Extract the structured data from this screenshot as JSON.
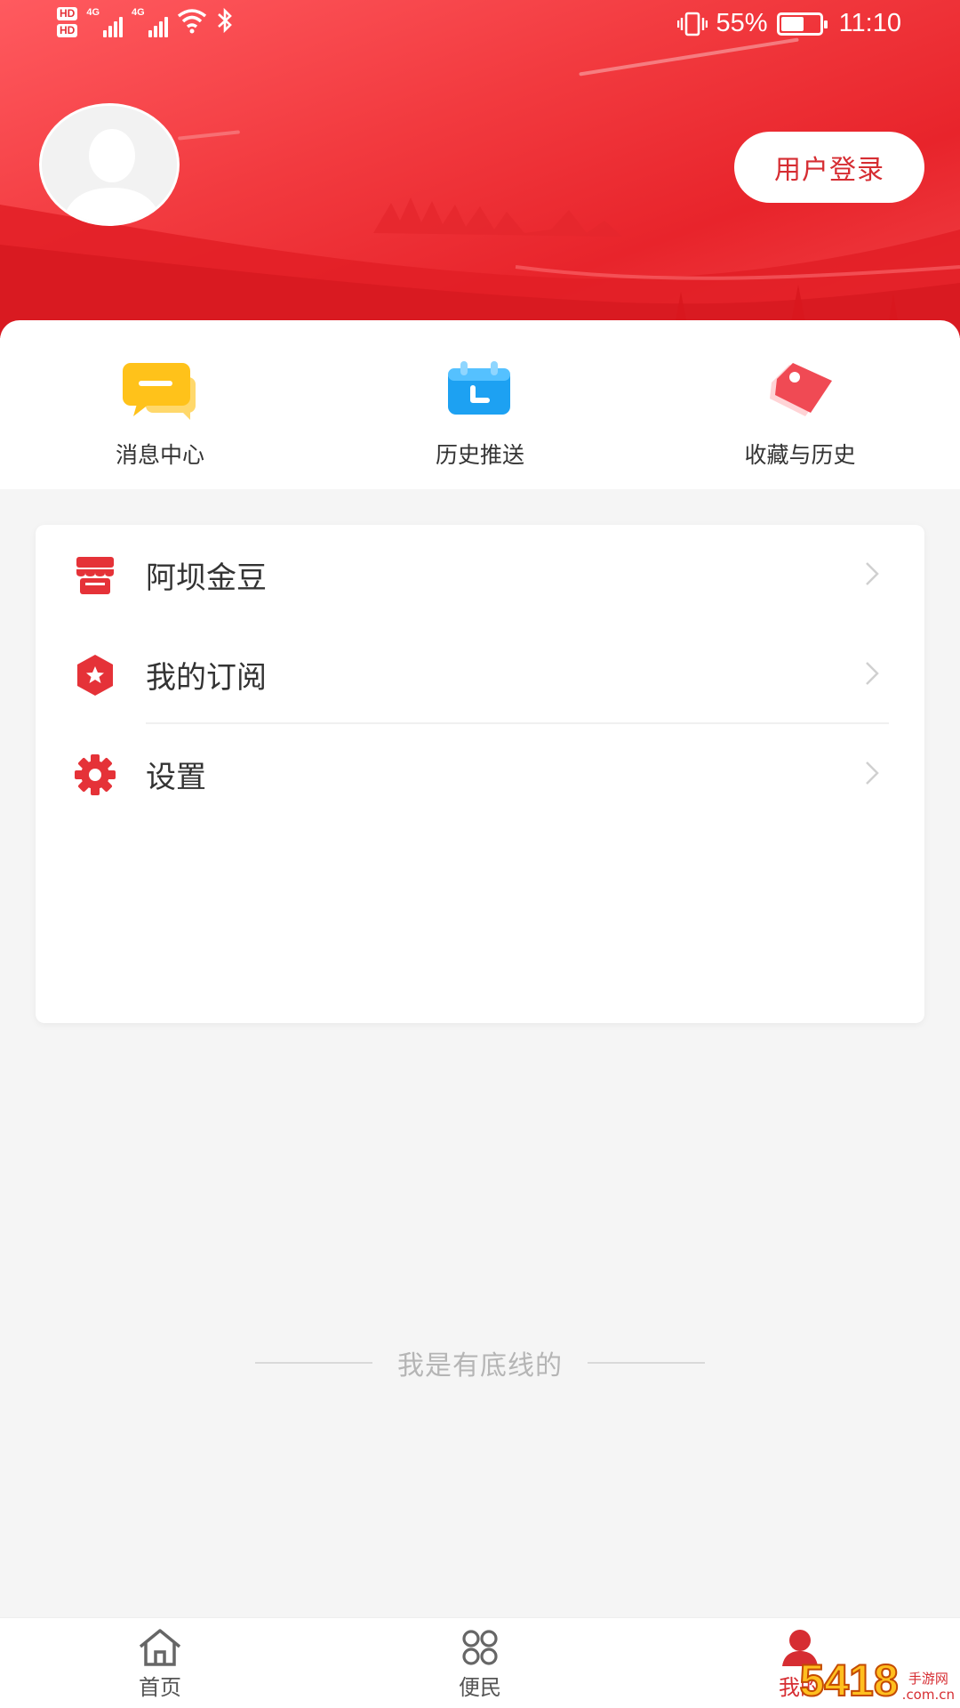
{
  "status_bar": {
    "sim1": "HD",
    "sim2": "HD",
    "net1": "4G",
    "net2": "4G",
    "battery_percent": "55%",
    "battery_level": 0.55,
    "time": "11:10"
  },
  "header": {
    "login_label": "用户登录"
  },
  "shortcuts": [
    {
      "label": "消息中心",
      "icon": "message-icon"
    },
    {
      "label": "历史推送",
      "icon": "calendar-icon"
    },
    {
      "label": "收藏与历史",
      "icon": "tag-icon"
    }
  ],
  "menu": [
    {
      "label": "阿坝金豆",
      "icon": "shop-icon"
    },
    {
      "label": "我的订阅",
      "icon": "star-badge-icon"
    },
    {
      "label": "设置",
      "icon": "gear-icon"
    }
  ],
  "footer_note": "我是有底线的",
  "tabbar": [
    {
      "label": "首页",
      "icon": "home-icon",
      "active": false
    },
    {
      "label": "便民",
      "icon": "grid-icon",
      "active": false
    },
    {
      "label": "我的",
      "icon": "user-icon",
      "active": true
    }
  ],
  "watermark": {
    "number": "5418",
    "site_name": "手游网",
    "site_domain": ".com.cn"
  },
  "colors": {
    "brand_red": "#e53238",
    "login_text": "#d62d32",
    "header_light": "#ff5a5f",
    "header_dark": "#e8242b"
  }
}
